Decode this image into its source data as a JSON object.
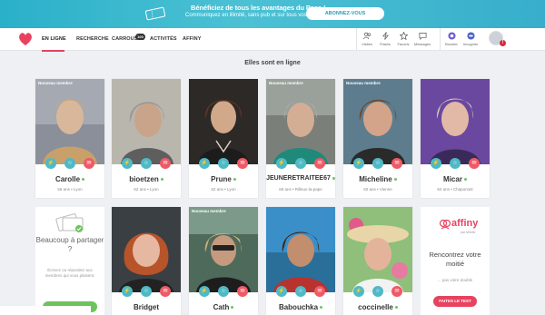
{
  "banner": {
    "line1": "Bénéficiez de tous les avantages du Pass !",
    "line2": "Communiquez en illimité, sans pub et sur tous vos écrans.",
    "button": "ABONNEZ-VOUS"
  },
  "nav": {
    "items": [
      "EN LIGNE",
      "RECHERCHE",
      "CARROUSEL",
      "ACTIVITÉS",
      "AFFINY"
    ],
    "carousel_badge": "100"
  },
  "toolbar": {
    "items": [
      "Visites",
      "Flashs",
      "Favoris",
      "Messages",
      "Booster",
      "Incognito"
    ]
  },
  "alert_count": "!",
  "heading": "Elles sont en ligne",
  "new_member_label": "Nouveau membre",
  "profiles_row1": [
    {
      "name": "Carolle",
      "info": "56 ans • Lyon",
      "new": true
    },
    {
      "name": "bioetzen",
      "info": "62 ans • Lyon",
      "new": false
    },
    {
      "name": "Prune",
      "info": "62 ans • Lyon",
      "new": false
    },
    {
      "name": "JEUNERETRAITEE67",
      "info": "66 ans • Rilleux-la-pape",
      "new": true
    },
    {
      "name": "Micheline",
      "info": "60 ans • Vienne",
      "new": true
    },
    {
      "name": "Micar",
      "info": "62 ans • Chaponost",
      "new": false
    }
  ],
  "profiles_row2": [
    {
      "name": "Bridget",
      "new": false
    },
    {
      "name": "Cath",
      "new": true
    },
    {
      "name": "Babouchka",
      "new": false
    },
    {
      "name": "coccinelle",
      "new": false
    }
  ],
  "promo_share": {
    "title": "Beaucoup à partager ?",
    "subtitle": "Écrivez ou répondez aux membres qui vous plaisent."
  },
  "promo_affiny": {
    "logo": "affiny",
    "logo_sub": "par Meetic",
    "title": "Rencontrez votre moitié",
    "subtitle": "... pas votre double",
    "button": "FAITES LE TEST"
  },
  "colors": {
    "accent": "#e8425f",
    "teal": "#4fb9c5",
    "online": "#6bc36b"
  }
}
